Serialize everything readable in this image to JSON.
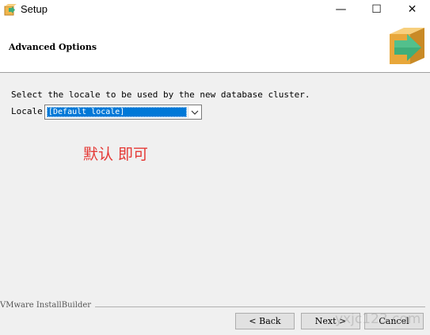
{
  "window": {
    "title": "Setup",
    "minimize_glyph": "—",
    "maximize_glyph": "☐",
    "close_glyph": "✕"
  },
  "header": {
    "title": "Advanced Options",
    "logo_icon": "box-arrow-icon"
  },
  "content": {
    "description": "Select the locale to be used by the new database cluster.",
    "locale_label": "Locale",
    "locale_selected": "[Default locale]",
    "annotation": "默认 即可",
    "annotation_color": "#e53935"
  },
  "footer": {
    "brand": "VMware InstallBuilder",
    "back_label": "< Back",
    "next_label": "Next >",
    "cancel_label": "Cancel",
    "watermark": "yxjc123.com"
  },
  "colors": {
    "selection": "#0078d7",
    "logo_box": "#f2b64c",
    "logo_arrow": "#3fae7a"
  }
}
